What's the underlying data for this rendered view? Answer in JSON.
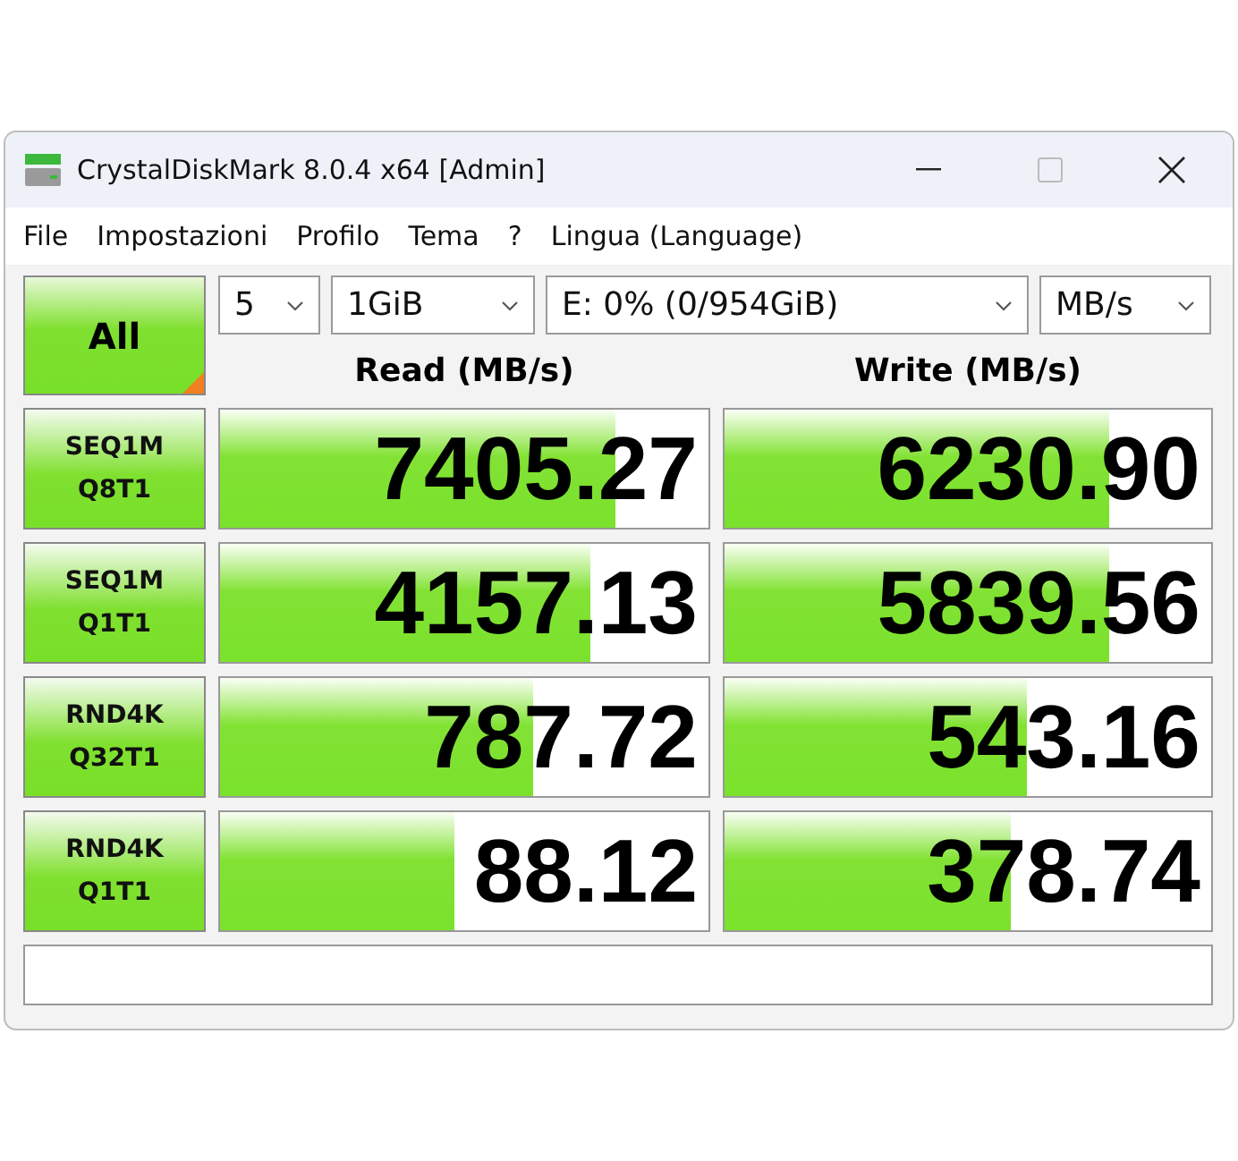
{
  "window": {
    "title": "CrystalDiskMark 8.0.4 x64 [Admin]"
  },
  "menu": [
    "File",
    "Impostazioni",
    "Profilo",
    "Tema",
    "?",
    "Lingua (Language)"
  ],
  "all_button": "All",
  "selectors": {
    "count": "5",
    "size": "1GiB",
    "drive": "E: 0% (0/954GiB)",
    "unit": "MB/s"
  },
  "headers": {
    "read": "Read (MB/s)",
    "write": "Write (MB/s)"
  },
  "tests": [
    {
      "line1": "SEQ1M",
      "line2": "Q8T1",
      "read": {
        "value": "7405.27",
        "level": 0.81
      },
      "write": {
        "value": "6230.90",
        "level": 0.79
      }
    },
    {
      "line1": "SEQ1M",
      "line2": "Q1T1",
      "read": {
        "value": "4157.13",
        "level": 0.76
      },
      "write": {
        "value": "5839.56",
        "level": 0.79
      }
    },
    {
      "line1": "RND4K",
      "line2": "Q32T1",
      "read": {
        "value": "787.72",
        "level": 0.64
      },
      "write": {
        "value": "543.16",
        "level": 0.62
      }
    },
    {
      "line1": "RND4K",
      "line2": "Q1T1",
      "read": {
        "value": "88.12",
        "level": 0.48
      },
      "write": {
        "value": "378.74",
        "level": 0.59
      }
    }
  ]
}
